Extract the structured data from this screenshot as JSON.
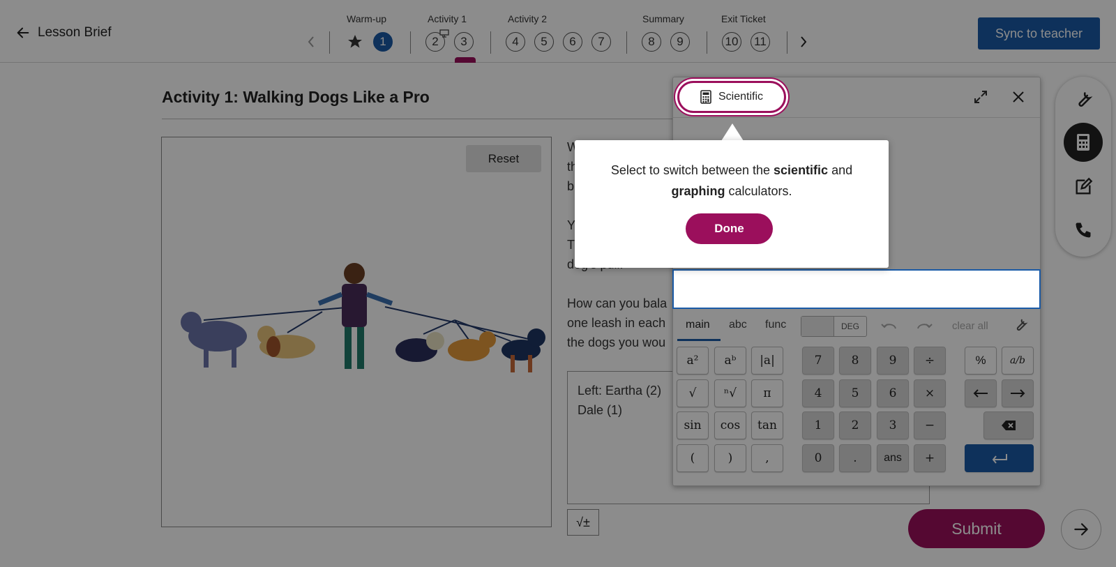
{
  "header": {
    "back_label": "Lesson Brief",
    "sections": [
      "Warm-up",
      "Activity 1",
      "Activity 2",
      "Summary",
      "Exit Ticket"
    ],
    "items": [
      "1",
      "2",
      "3",
      "4",
      "5",
      "6",
      "7",
      "8",
      "9",
      "10",
      "11"
    ],
    "active_item": "1",
    "current_item": "3",
    "sync_label": "Sync to teacher"
  },
  "activity": {
    "title": "Activity 1: Walking Dogs Like a Pro",
    "reset_label": "Reset",
    "question_lines": [
      "W",
      "th",
      "b",
      "Y",
      "T",
      "dog's pull.",
      "How can you bala",
      "one leash in each",
      "the dogs you wou"
    ],
    "answer_lines": [
      "Left: Eartha (2)",
      "Dale (1)"
    ],
    "math_button": "√±",
    "submit_label": "Submit"
  },
  "calculator": {
    "mode_label": "Scientific",
    "tabs": [
      "main",
      "abc",
      "func"
    ],
    "angle_mode": "DEG",
    "clear_all_label": "clear all",
    "functions": [
      [
        "a²",
        "aᵇ",
        "|a|"
      ],
      [
        "√",
        "ⁿ√",
        "π"
      ],
      [
        "sin",
        "cos",
        "tan"
      ],
      [
        "(",
        ")",
        ","
      ]
    ],
    "numbers": [
      [
        "7",
        "8",
        "9",
        "÷"
      ],
      [
        "4",
        "5",
        "6",
        "×"
      ],
      [
        "1",
        "2",
        "3",
        "−"
      ],
      [
        "0",
        ".",
        "ans",
        "+"
      ]
    ],
    "extra": {
      "percent": "%",
      "fraction": "a/b"
    }
  },
  "tooltip": {
    "text_before": "Select to switch between the ",
    "bold1": "scientific",
    "text_mid": " and ",
    "bold2": "graphing",
    "text_after": " calculators.",
    "done_label": "Done"
  },
  "colors": {
    "brand": "#1a5aa6",
    "accent": "#9b0f5c"
  }
}
